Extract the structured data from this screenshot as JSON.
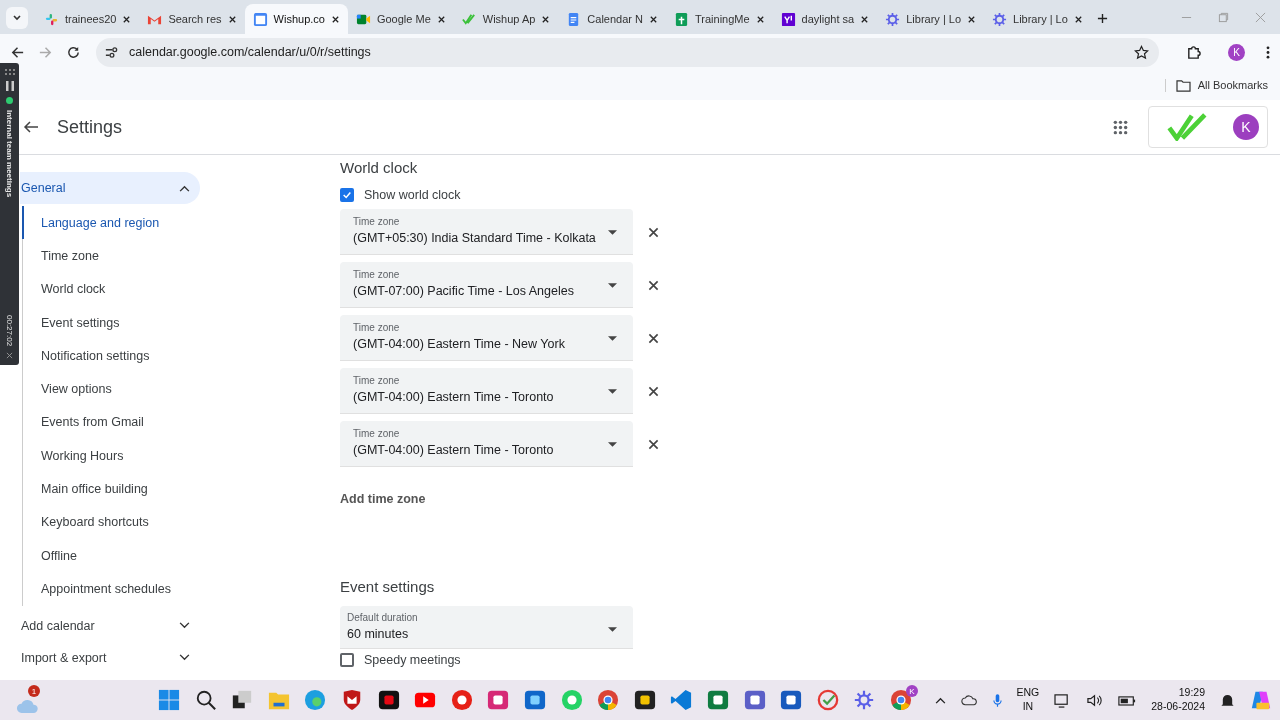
{
  "browser": {
    "tabs": [
      {
        "title": "trainees20",
        "selected": false
      },
      {
        "title": "Search res",
        "selected": false
      },
      {
        "title": "Wishup.co",
        "selected": true
      },
      {
        "title": "Google Me",
        "selected": false
      },
      {
        "title": "Wishup Ap",
        "selected": false
      },
      {
        "title": "Calendar N",
        "selected": false
      },
      {
        "title": "TrainingMe",
        "selected": false
      },
      {
        "title": "daylight sa",
        "selected": false
      },
      {
        "title": "Library | Lo",
        "selected": false
      },
      {
        "title": "Library | Lo",
        "selected": false
      }
    ],
    "url": "calendar.google.com/calendar/u/0/r/settings",
    "bookmarks": "All Bookmarks",
    "profile_initial": "K"
  },
  "recording_widget": {
    "title": "Internal team meetings",
    "elapsed": "00:27:02"
  },
  "header": {
    "title": "Settings",
    "avatar_initial": "K"
  },
  "sidebar": {
    "sections": [
      {
        "label": "General",
        "expanded": true,
        "children": [
          {
            "label": "Language and region",
            "selected": true
          },
          {
            "label": "Time zone",
            "selected": false
          },
          {
            "label": "World clock",
            "selected": false
          },
          {
            "label": "Event settings",
            "selected": false
          },
          {
            "label": "Notification settings",
            "selected": false
          },
          {
            "label": "View options",
            "selected": false
          },
          {
            "label": "Events from Gmail",
            "selected": false
          },
          {
            "label": "Working Hours",
            "selected": false
          },
          {
            "label": "Main office building",
            "selected": false
          },
          {
            "label": "Keyboard shortcuts",
            "selected": false
          },
          {
            "label": "Offline",
            "selected": false
          },
          {
            "label": "Appointment schedules",
            "selected": false
          }
        ]
      },
      {
        "label": "Add calendar",
        "expanded": false
      },
      {
        "label": "Import & export",
        "expanded": false
      }
    ]
  },
  "world_clock": {
    "heading": "World clock",
    "show_world_clock": {
      "label": "Show world clock",
      "checked": true
    },
    "time_zones": [
      {
        "label": "Time zone",
        "value": "(GMT+05:30) India Standard Time - Kolkata"
      },
      {
        "label": "Time zone",
        "value": "(GMT-07:00) Pacific Time - Los Angeles"
      },
      {
        "label": "Time zone",
        "value": "(GMT-04:00) Eastern Time - New York"
      },
      {
        "label": "Time zone",
        "value": "(GMT-04:00) Eastern Time - Toronto"
      },
      {
        "label": "Time zone",
        "value": "(GMT-04:00) Eastern Time - Toronto"
      }
    ],
    "add_link": "Add time zone"
  },
  "event_settings": {
    "heading": "Event settings",
    "default_duration": {
      "label": "Default duration",
      "value": "60 minutes"
    },
    "speedy_meetings": {
      "label": "Speedy meetings",
      "checked": false
    }
  },
  "taskbar": {
    "weather_badge": "1",
    "language": "ENG",
    "region": "IN",
    "time": "19:29",
    "date": "28-06-2024",
    "chrome_badge": "K"
  }
}
